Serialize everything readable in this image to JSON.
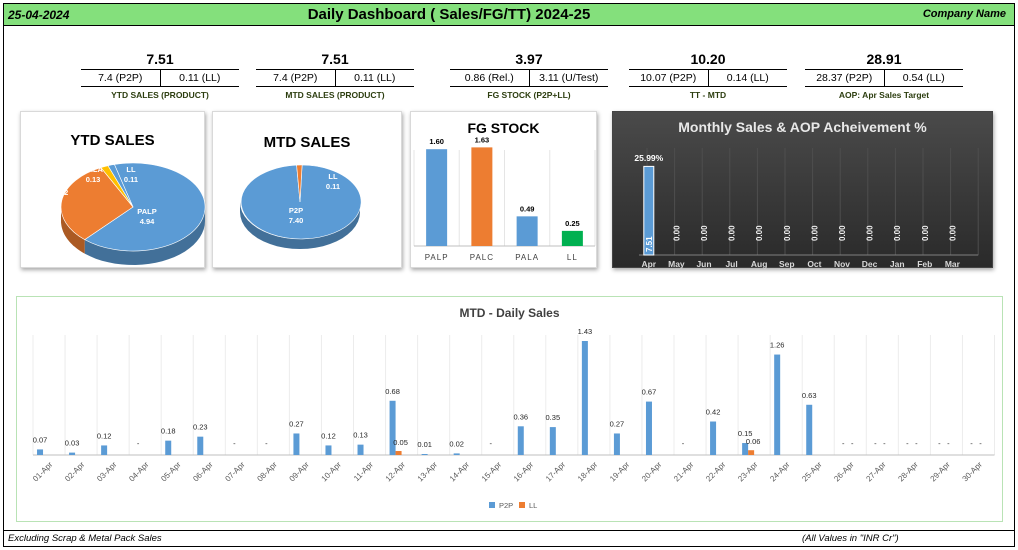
{
  "header": {
    "date": "25-04-2024",
    "title": "Daily Dashboard ( Sales/FG/TT) 2024-25",
    "company": "Company Name"
  },
  "kpis": [
    {
      "value": "7.51",
      "left": "7.4 (P2P)",
      "right": "0.11 (LL)",
      "label": "YTD SALES (PRODUCT)"
    },
    {
      "value": "7.51",
      "left": "7.4 (P2P)",
      "right": "0.11 (LL)",
      "label": "MTD SALES (PRODUCT)"
    },
    {
      "value": "3.97",
      "left": "0.86 (Rel.)",
      "right": "3.11 (U/Test)",
      "label": "FG STOCK (P2P+LL)"
    },
    {
      "value": "10.20",
      "left": "10.07 (P2P)",
      "right": "0.14 (LL)",
      "label": "TT - MTD"
    },
    {
      "value": "28.91",
      "left": "28.37 (P2P)",
      "right": "0.54 (LL)",
      "label": "AOP: Apr Sales Target"
    }
  ],
  "footer": {
    "left": "Excluding Scrap & Metal Pack Sales",
    "right": "(All Values in \"INR Cr\")"
  },
  "colors": {
    "blue": "#5b9bd5",
    "orange": "#ed7d31",
    "green": "#00b050",
    "gold": "#ffc000",
    "header_bg": "#84e07c"
  },
  "chart_data": [
    {
      "type": "pie",
      "title": "YTD SALES",
      "slices": [
        {
          "name": "PALP",
          "value": 4.94,
          "color": "#5b9bd5"
        },
        {
          "name": "PALC",
          "value": 2.32,
          "color": "#ed7d31"
        },
        {
          "name": "PALA",
          "value": 0.13,
          "color": "#ffc000"
        },
        {
          "name": "LL",
          "value": 0.11,
          "color": "#5b9bd5"
        }
      ]
    },
    {
      "type": "pie",
      "title": "MTD SALES",
      "slices": [
        {
          "name": "P2P",
          "value": 7.4,
          "color": "#5b9bd5"
        },
        {
          "name": "LL",
          "value": 0.11,
          "color": "#ed7d31"
        }
      ]
    },
    {
      "type": "bar",
      "title": "FG STOCK",
      "categories": [
        "PALP",
        "PALC",
        "PALA",
        "LL"
      ],
      "values": [
        1.6,
        1.63,
        0.49,
        0.25
      ],
      "colors": [
        "#5b9bd5",
        "#ed7d31",
        "#5b9bd5",
        "#00b050"
      ],
      "ylim": [
        0,
        2
      ]
    },
    {
      "type": "bar",
      "title": "Monthly Sales & AOP Acheivement %",
      "categories": [
        "Apr",
        "May",
        "Jun",
        "Jul",
        "Aug",
        "Sep",
        "Oct",
        "Nov",
        "Dec",
        "Jan",
        "Feb",
        "Mar"
      ],
      "values": [
        7.51,
        0,
        0,
        0,
        0,
        0,
        0,
        0,
        0,
        0,
        0,
        0
      ],
      "labels": [
        "7.51",
        "0.00",
        "0.00",
        "0.00",
        "0.00",
        "0.00",
        "0.00",
        "0.00",
        "0.00",
        "0.00",
        "0.00",
        "0.00"
      ],
      "annotations": [
        "25.99%"
      ],
      "ylim": [
        0,
        10
      ]
    },
    {
      "type": "bar",
      "title": "MTD - Daily Sales",
      "categories": [
        "01-Apr",
        "02-Apr",
        "03-Apr",
        "04-Apr",
        "05-Apr",
        "06-Apr",
        "07-Apr",
        "08-Apr",
        "09-Apr",
        "10-Apr",
        "11-Apr",
        "12-Apr",
        "13-Apr",
        "14-Apr",
        "15-Apr",
        "16-Apr",
        "17-Apr",
        "18-Apr",
        "19-Apr",
        "20-Apr",
        "21-Apr",
        "22-Apr",
        "23-Apr",
        "24-Apr",
        "25-Apr",
        "26-Apr",
        "27-Apr",
        "28-Apr",
        "29-Apr",
        "30-Apr"
      ],
      "series": [
        {
          "name": "P2P",
          "color": "#5b9bd5",
          "values": [
            0.07,
            0.03,
            0.12,
            null,
            0.18,
            0.23,
            null,
            null,
            0.27,
            0.12,
            0.13,
            0.68,
            0.01,
            0.02,
            null,
            0.36,
            0.35,
            1.43,
            0.27,
            0.67,
            null,
            0.42,
            0.15,
            1.26,
            0.63,
            null,
            null,
            null,
            null,
            null
          ],
          "labels": [
            "0.07",
            "0.03",
            "0.12",
            "-",
            "0.18",
            "0.23",
            "-",
            "-",
            "0.27",
            "0.12",
            "0.13",
            "0.68",
            "0.01",
            "0.02",
            "-",
            "0.36",
            "0.35",
            "1.43",
            "0.27",
            "0.67",
            "-",
            "0.42",
            "0.15",
            "1.26",
            "0.63",
            "-",
            "-",
            "-",
            "-",
            "-"
          ]
        },
        {
          "name": "LL",
          "color": "#ed7d31",
          "values": [
            null,
            null,
            null,
            null,
            null,
            null,
            null,
            null,
            null,
            null,
            null,
            0.05,
            null,
            null,
            null,
            null,
            null,
            null,
            null,
            null,
            null,
            null,
            0.06,
            null,
            null,
            null,
            null,
            null,
            null,
            null
          ],
          "labels": [
            "",
            "",
            "",
            "",
            "",
            "",
            "",
            "",
            "",
            "",
            "",
            "0.05",
            "",
            "",
            "",
            "",
            "",
            "",
            "",
            "",
            "",
            "",
            "0.06",
            "",
            "",
            "-",
            "-",
            "-",
            "-",
            "-"
          ]
        }
      ],
      "ylim": [
        0,
        1.6
      ],
      "legend": "bottom-center"
    }
  ]
}
